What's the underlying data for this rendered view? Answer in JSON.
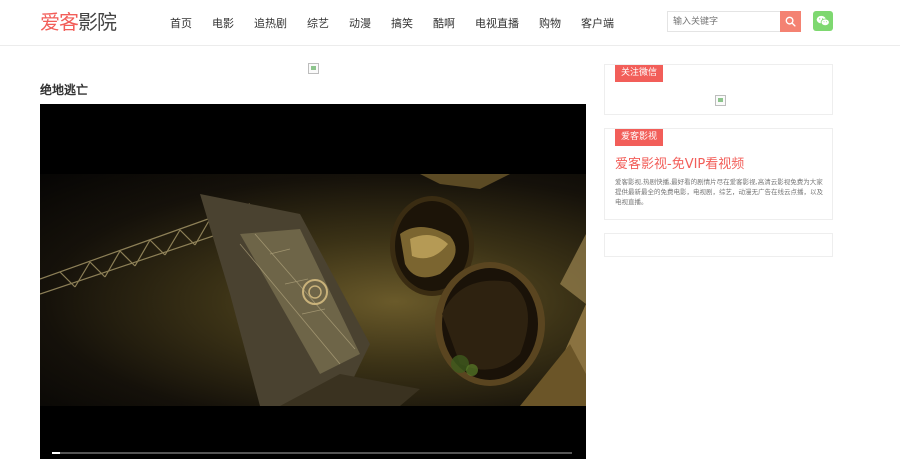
{
  "header": {
    "logo_red": "爱客",
    "logo_dark": "影院",
    "nav": [
      "首页",
      "电影",
      "追热剧",
      "综艺",
      "动漫",
      "搞笑",
      "酷啊",
      "电视直播",
      "购物",
      "客户端"
    ],
    "search_placeholder": "输入关键字"
  },
  "main": {
    "movie_title": "绝地逃亡",
    "progress_fraction": 0.015
  },
  "sidebar": {
    "wechat_panel": {
      "tag": "关注微信"
    },
    "promo_panel": {
      "tag": "爱客影视",
      "headline": "爱客影视-免VIP看视频",
      "description": "爱客影视,热剧快播,最好看的剧情片尽在爱客影视,高清云影视免费为大家提供最新最全的免费电影，电视剧，综艺，动漫无广告在线云点播，以及电视直播。"
    }
  },
  "colors": {
    "accent": "#f25e59",
    "search_button": "#f48272",
    "wechat": "#7ed870"
  }
}
